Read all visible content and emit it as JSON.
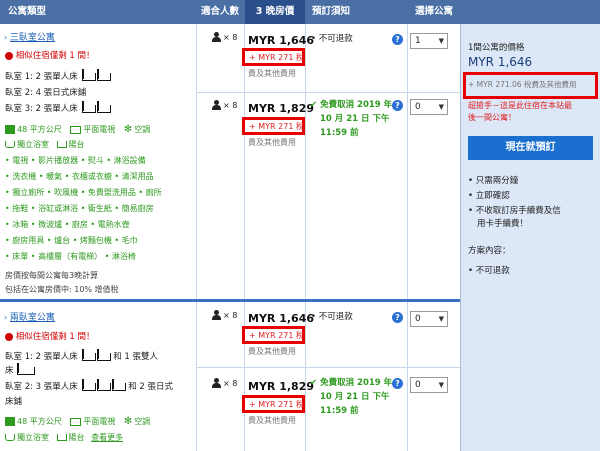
{
  "header": {
    "col_type": "公寓類型",
    "col_guests": "適合人數",
    "col_price": "3 晚房價",
    "col_notice": "預訂須知",
    "col_select": "選擇公寓"
  },
  "room1": {
    "name": "三臥室公寓",
    "urgency": "相似住宿僅剩 1 間！",
    "bed1": "臥室 1: 2 張單人床",
    "bed2": "臥室 2: 4 張日式床鋪",
    "bed3": "臥室 3: 2 張單人床",
    "fac_line1": {
      "area": "48 平方公尺",
      "tv": "平面電視",
      "ac": "空調"
    },
    "fac_line2": {
      "bath": "獨立浴室",
      "balcony": "陽台"
    },
    "amenities": [
      "• 電視 • 影片播放器 • 熨斗 • 淋浴設備",
      "• 洗衣機 • 暖氣 • 衣櫃或衣櫥 • 清潔用品",
      "• 獨立廁所 • 吹風機 • 免費盥洗用品 • 廁所",
      "• 拖鞋 • 浴缸或淋浴 • 衛生紙 • 簡易廚房",
      "• 冰箱 • 微波爐 • 廚房 • 電熱水壺",
      "• 廚房用具 • 爐台 • 烤麵包機 • 毛巾",
      "• 床單 • 高樓層（有電梯） • 淋浴椅"
    ],
    "price_note1": "房價按每間公寓每3晚計算",
    "price_note2": "包括在公寓房價中: 10% 增值稅",
    "opt1": {
      "guests": "× 8",
      "price": "MYR 1,646",
      "tax": "+ MYR 271 稅",
      "note": "費及其他費用",
      "notice": "• 不可退款",
      "qty": "1"
    },
    "opt2": {
      "guests": "× 8",
      "price": "MYR 1,829",
      "tax": "+ MYR 271 稅",
      "note": "費及其他費用",
      "notice_line1": "免費取消 2019 年",
      "notice_line2": "10 月 21 日 下午",
      "notice_line3": "11:59 前",
      "qty": "0"
    }
  },
  "room2": {
    "name": "兩臥室公寓",
    "urgency": "相似住宿僅剩 1 間！",
    "bed1a": "臥室 1: 2 張單人床",
    "bed1b": "和 1 張雙人",
    "bed1c": "床",
    "bed2a": "臥室 2: 3 張單人床",
    "bed2b": "和 2 張日式",
    "bed2c": "床鋪",
    "fac_line1": {
      "area": "48 平方公尺",
      "tv": "平面電視",
      "ac": "空調"
    },
    "fac_line2": {
      "bath": "獨立浴室",
      "balcony": "陽台",
      "more": "查看更多"
    },
    "opt1": {
      "guests": "× 8",
      "price": "MYR 1,646",
      "tax": "+ MYR 271 稅",
      "note": "費及其他費用",
      "notice": "• 不可退款",
      "qty": "0"
    },
    "opt2": {
      "guests": "× 8",
      "price": "MYR 1,829",
      "tax": "+ MYR 271 稅",
      "note": "費及其他費用",
      "notice_line1": "免費取消 2019 年",
      "notice_line2": "10 月 21 日 下午",
      "notice_line3": "11:59 前",
      "qty": "0"
    }
  },
  "sidebar": {
    "summary": "1間公寓的價格",
    "price": "MYR 1,646",
    "tax": "+ MYR 271.06 稅費及其他費用",
    "promo_line1": "超搶手－這是此住宿在本站最",
    "promo_line2": "後一間公寓！",
    "book_button": "現在就預訂",
    "bullets": [
      "只需兩分鐘",
      "立即確認",
      "不收取訂房手續費及信",
      "用卡手續費！"
    ],
    "policy_title": "方案內容：",
    "policy_item": "不可退款"
  },
  "colors": {
    "header": "#4a6fa5",
    "header_selected": "#2b4f8c",
    "accent": "#1a6fcf",
    "highlight": "#e80000",
    "sidebar_bg": "#dce7f7"
  }
}
